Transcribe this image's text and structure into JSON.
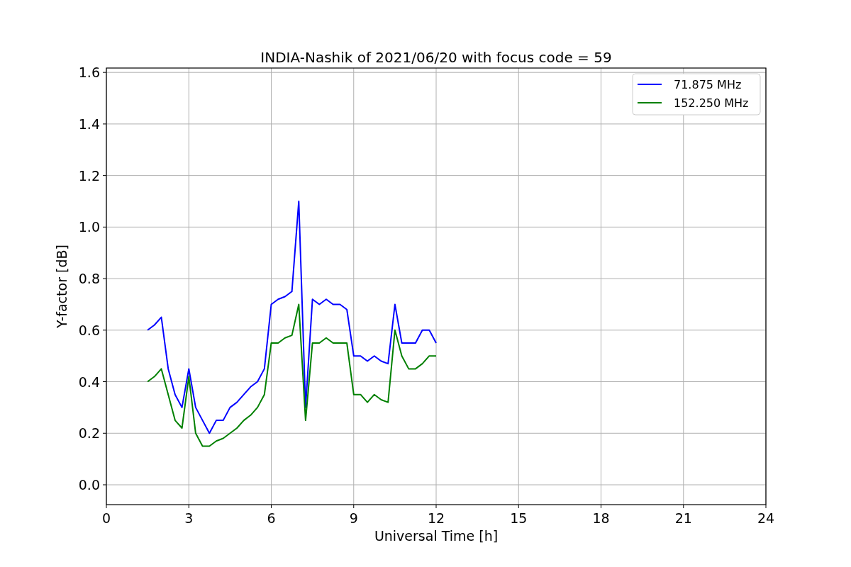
{
  "chart_data": {
    "type": "line",
    "title": "INDIA-Nashik of 2021/06/20 with focus code = 59",
    "xlabel": "Universal Time [h]",
    "ylabel": "Y-factor [dB]",
    "x": [
      1.5,
      1.75,
      2,
      2.25,
      2.5,
      2.75,
      3,
      3.25,
      3.5,
      3.75,
      4,
      4.25,
      4.5,
      4.75,
      5,
      5.25,
      5.5,
      5.75,
      6,
      6.25,
      6.5,
      6.75,
      7,
      7.25,
      7.5,
      7.75,
      8,
      8.25,
      8.5,
      8.75,
      9,
      9.25,
      9.5,
      9.75,
      10,
      10.25,
      10.5,
      10.75,
      11,
      11.25,
      11.5,
      11.75,
      12
    ],
    "series": [
      {
        "name": "71.875 MHz",
        "color": "#0000ff",
        "values": [
          0.6,
          0.62,
          0.65,
          0.45,
          0.35,
          0.3,
          0.45,
          0.3,
          0.25,
          0.2,
          0.25,
          0.25,
          0.3,
          0.32,
          0.35,
          0.38,
          0.4,
          0.45,
          0.7,
          0.72,
          0.73,
          0.75,
          1.1,
          0.3,
          0.72,
          0.7,
          0.72,
          0.7,
          0.7,
          0.68,
          0.5,
          0.5,
          0.48,
          0.5,
          0.48,
          0.47,
          0.7,
          0.55,
          0.55,
          0.55,
          0.6,
          0.6,
          0.55
        ]
      },
      {
        "name": "152.250 MHz",
        "color": "#008000",
        "values": [
          0.4,
          0.42,
          0.45,
          0.35,
          0.25,
          0.22,
          0.42,
          0.2,
          0.15,
          0.15,
          0.17,
          0.18,
          0.2,
          0.22,
          0.25,
          0.27,
          0.3,
          0.35,
          0.55,
          0.55,
          0.57,
          0.58,
          0.7,
          0.25,
          0.55,
          0.55,
          0.57,
          0.55,
          0.55,
          0.55,
          0.35,
          0.35,
          0.32,
          0.35,
          0.33,
          0.32,
          0.6,
          0.5,
          0.45,
          0.45,
          0.47,
          0.5,
          0.5
        ]
      }
    ],
    "grid": true,
    "legend": true,
    "xlim": [
      0,
      24
    ],
    "ylim": [
      -0.077,
      1.617
    ],
    "xticks": [
      0,
      3,
      6,
      9,
      12,
      15,
      18,
      21,
      24
    ],
    "yticks": [
      {
        "value": 0,
        "label": "0.0"
      },
      {
        "value": 0.2,
        "label": "0.2"
      },
      {
        "value": 0.4,
        "label": "0.4"
      },
      {
        "value": 0.6,
        "label": "0.6"
      },
      {
        "value": 0.8,
        "label": "0.8"
      },
      {
        "value": 1,
        "label": "1.0"
      },
      {
        "value": 1.2,
        "label": "1.2"
      },
      {
        "value": 1.4,
        "label": "1.4"
      },
      {
        "value": 1.6,
        "label": "1.6"
      }
    ]
  }
}
